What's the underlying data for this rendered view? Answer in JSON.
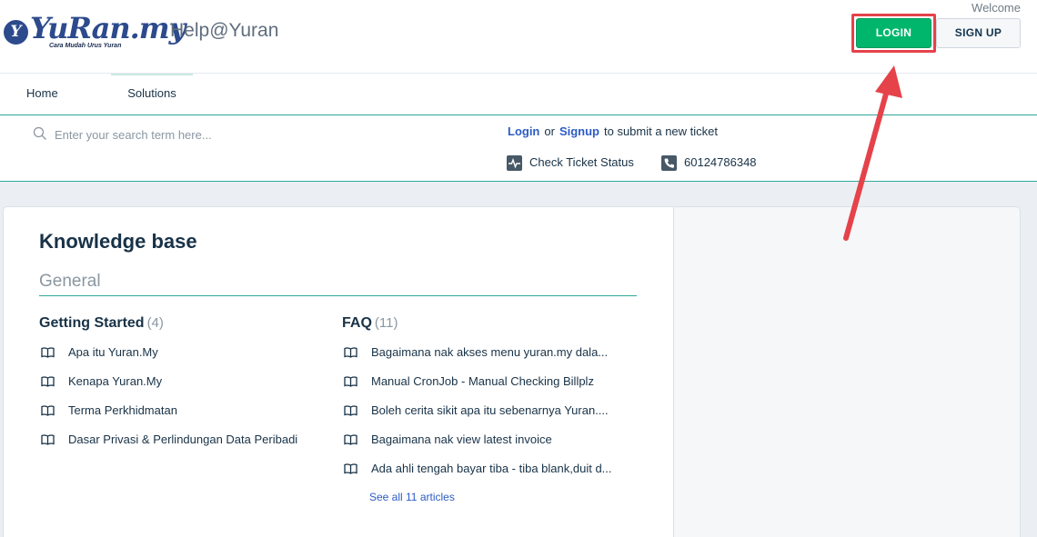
{
  "header": {
    "logo_text": "YuRan.my",
    "logo_letter": "Y",
    "logo_tagline": "Cara Mudah Urus Yuran",
    "portal_name": "Help@Yuran",
    "welcome": "Welcome",
    "login_label": "LOGIN",
    "signup_label": "SIGN UP"
  },
  "nav": {
    "home": "Home",
    "solutions": "Solutions"
  },
  "search": {
    "placeholder": "Enter your search term here...",
    "login_link": "Login",
    "or_text": "or",
    "signup_link": "Signup",
    "submit_text": "to submit a new ticket",
    "check_status": "Check Ticket Status",
    "phone": "60124786348"
  },
  "kb": {
    "title": "Knowledge base",
    "section": "General",
    "categories": [
      {
        "title": "Getting Started",
        "count": "(4)",
        "articles": [
          "Apa itu Yuran.My",
          "Kenapa Yuran.My",
          "Terma Perkhidmatan",
          "Dasar Privasi & Perlindungan Data Peribadi"
        ]
      },
      {
        "title": "FAQ",
        "count": "(11)",
        "articles": [
          "Bagaimana nak akses menu yuran.my dala...",
          "Manual CronJob - Manual Checking Billplz",
          "Boleh cerita sikit apa itu sebenarnya Yuran....",
          "Bagaimana nak view latest invoice",
          "Ada ahli tengah bayar tiba - tiba blank,duit d..."
        ],
        "see_all": "See all 11 articles"
      }
    ]
  },
  "colors": {
    "brand": "#2c4a8c",
    "login_green": "#00b66c",
    "accent_teal": "#2fa89a",
    "link_blue": "#2c5cc5",
    "annotation_red": "#e5424a"
  },
  "icons": [
    "search-icon",
    "activity-icon",
    "phone-icon",
    "book-icon",
    "arrow-annotation"
  ]
}
